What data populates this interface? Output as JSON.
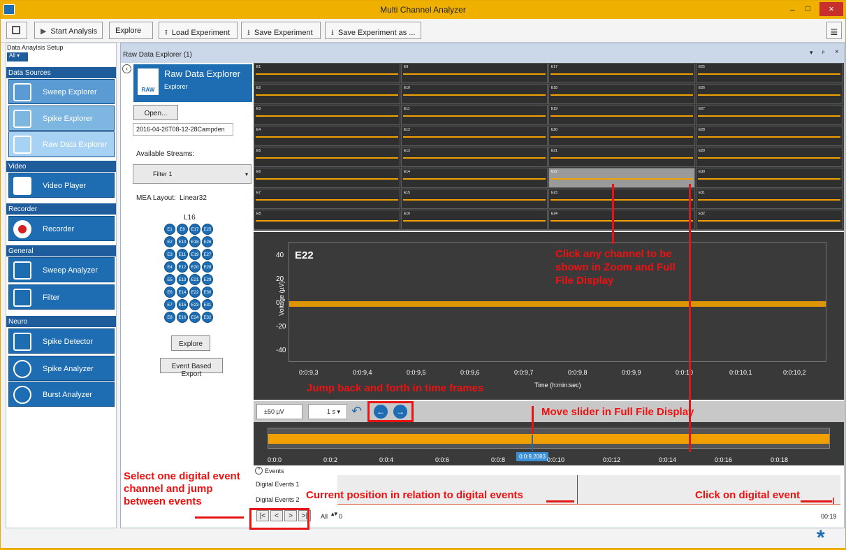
{
  "window": {
    "title": "Multi Channel Analyzer",
    "controls": [
      "–",
      "□",
      "×"
    ]
  },
  "toolbar": {
    "start": "Start Analysis",
    "explore": "Explore",
    "load": "Load Experiment",
    "save": "Save Experiment",
    "saveas": "Save Experiment as ..."
  },
  "left": {
    "header": "Data Anaylsis Setup",
    "filter": "All ▾",
    "sections": [
      {
        "title": "Data Sources",
        "items": [
          "Sweep Explorer",
          "Spike Explorer",
          "Raw Data Explorer"
        ]
      },
      {
        "title": "Video",
        "items": [
          "Video Player"
        ]
      },
      {
        "title": "Recorder",
        "items": [
          "Recorder"
        ]
      },
      {
        "title": "General",
        "items": [
          "Sweep Analyzer",
          "Filter"
        ]
      },
      {
        "title": "Neuro",
        "items": [
          "Spike Detector",
          "Spike Analyzer",
          "Burst Analyzer"
        ]
      }
    ]
  },
  "main": {
    "panel_title": "Raw Data Explorer (1)",
    "tool_title": "Raw Data Explorer",
    "tool_sub": "Explorer",
    "open": "Open...",
    "file": "2016-04-26T08-12-28Campden",
    "streams_label": "Available Streams:",
    "stream": "Filter 1",
    "layout_label": "MEA Layout:",
    "layout": "Linear32",
    "l16": "L16",
    "explore_btn": "Explore",
    "export_btn": "Event Based Export",
    "channels": [
      "E1",
      "E9",
      "E17",
      "E25",
      "E2",
      "E10",
      "E18",
      "E26",
      "E3",
      "E11",
      "E19",
      "E27",
      "E4",
      "E12",
      "E20",
      "E28",
      "E5",
      "E13",
      "E21",
      "E29",
      "E6",
      "E14",
      "E22",
      "E30",
      "E7",
      "E15",
      "E23",
      "E31",
      "E8",
      "E16",
      "E24",
      "E32"
    ],
    "zoom": {
      "channel": "E22",
      "ylabel": "Voltage (µV)",
      "xlabel": "Time (h:min:sec)",
      "yticks": [
        "40",
        "20",
        "0",
        "-20",
        "-40"
      ],
      "xticks": [
        "0:0:9,3",
        "0:0:9,4",
        "0:0:9,5",
        "0:0:9,6",
        "0:0:9,7",
        "0:0:9,8",
        "0:0:9,9",
        "0:0:10",
        "0:0:10,1",
        "0:0:10,2"
      ]
    },
    "controls": {
      "scale": "±50 µV",
      "time": "1 s ▾"
    },
    "full": {
      "xticks": [
        "0:0:0",
        "0:0:2",
        "0:0:4",
        "0:0:6",
        "0:0:8",
        "0:0:10",
        "0:0:12",
        "0:0:14",
        "0:0:16",
        "0:0:18"
      ],
      "cursor": "0:0:9,2083"
    },
    "events": {
      "title": "Events",
      "rows": [
        "Digital Events 1",
        "Digital Events 2"
      ],
      "all": "All",
      "start": "0",
      "end": "00:19",
      "nav": [
        "|<",
        "<",
        ">",
        ">|"
      ]
    }
  },
  "annotations": {
    "click_channel": "Click any channel to be shown in Zoom and Full File Display",
    "jump": "Jump back and forth in time frames",
    "slider": "Move slider in Full File Display",
    "digital": "Select one digital event channel and jump between events",
    "current": "Current position in relation to digital events",
    "click_event": "Click on digital event"
  }
}
